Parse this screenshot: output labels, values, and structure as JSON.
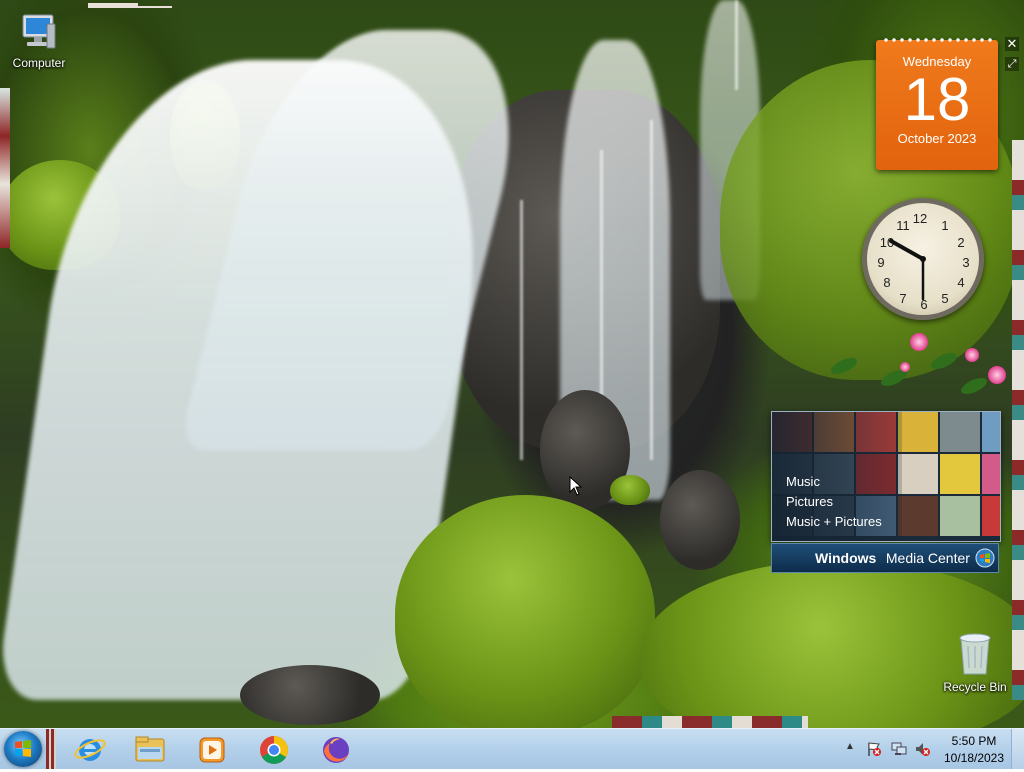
{
  "desktop": {
    "icons": [
      {
        "label": "Computer",
        "icon": "computer-icon"
      },
      {
        "label": "Recycle Bin",
        "icon": "recycle-bin-icon"
      }
    ]
  },
  "gadgets": {
    "calendar": {
      "weekday": "Wednesday",
      "day": "18",
      "month_year": "October 2023",
      "accent": "#e8680f"
    },
    "clock": {
      "time": "5:50",
      "numerals": [
        "12",
        "1",
        "2",
        "3",
        "4",
        "5",
        "6",
        "7",
        "8",
        "9",
        "10",
        "11"
      ]
    },
    "media_center": {
      "items": [
        "Music",
        "Pictures",
        "Music + Pictures"
      ],
      "brand_bold": "Windows",
      "brand_rest": " Media Center"
    },
    "controls": {
      "close": "✕",
      "resize": "⤢"
    }
  },
  "taskbar": {
    "start_icon": "windows-start-orb-icon",
    "apps": [
      {
        "name": "Internet Explorer",
        "icon": "internet-explorer-icon"
      },
      {
        "name": "Windows Explorer",
        "icon": "file-explorer-icon"
      },
      {
        "name": "Windows Media Player",
        "icon": "media-player-icon"
      },
      {
        "name": "Google Chrome",
        "icon": "chrome-icon"
      },
      {
        "name": "Mozilla Firefox",
        "icon": "firefox-icon"
      }
    ],
    "tray": {
      "show_hidden": "▲",
      "icons": [
        "action-center-icon",
        "network-icon",
        "volume-muted-icon"
      ],
      "time": "5:50 PM",
      "date": "10/18/2023"
    }
  }
}
